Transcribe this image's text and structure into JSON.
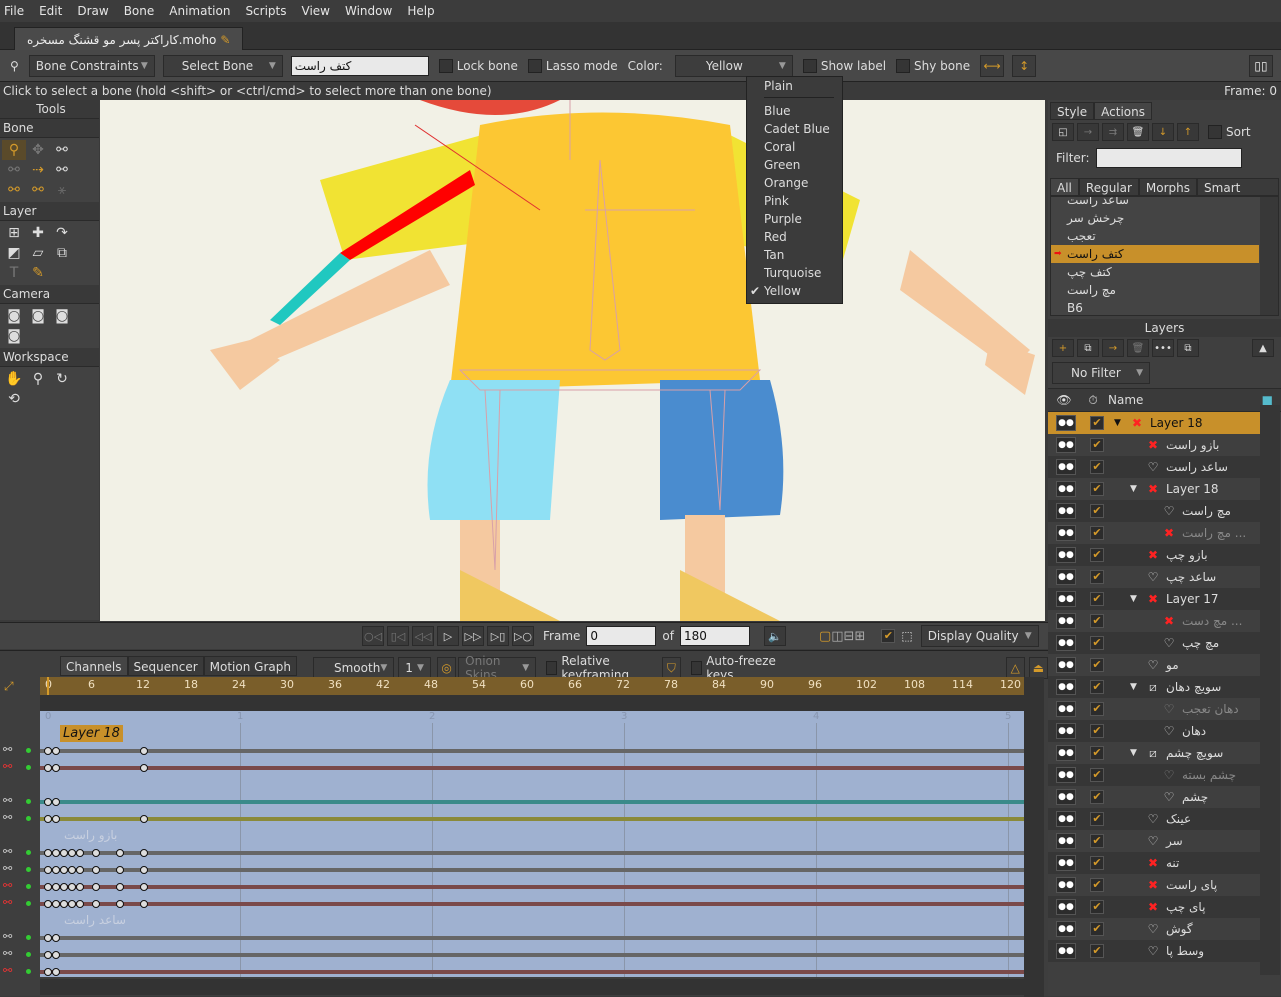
{
  "menu": [
    "File",
    "Edit",
    "Draw",
    "Bone",
    "Animation",
    "Scripts",
    "View",
    "Window",
    "Help"
  ],
  "document_tab": "کاراکتر پسر مو قشنگ مسخره.moho",
  "toolbar": {
    "constraints": "Bone Constraints",
    "select": "Select Bone",
    "bone_name": "کتف راست",
    "lock_bone": "Lock bone",
    "lasso": "Lasso mode",
    "color_label": "Color:",
    "color_value": "Yellow",
    "show_label": "Show label",
    "shy_bone": "Shy bone"
  },
  "status": {
    "hint": "Click to select a bone (hold <shift> or <ctrl/cmd> to select more than one bone)",
    "frame": "Frame: 0"
  },
  "tools": {
    "title": "Tools",
    "sections": [
      "Bone",
      "Layer",
      "Camera",
      "Workspace"
    ]
  },
  "color_menu": {
    "items": [
      "Plain",
      "Blue",
      "Cadet Blue",
      "Coral",
      "Green",
      "Orange",
      "Pink",
      "Purple",
      "Red",
      "Tan",
      "Turquoise",
      "Yellow"
    ],
    "selected": "Yellow"
  },
  "playback": {
    "frame_label": "Frame",
    "frame": "0",
    "of_label": "of",
    "total": "180",
    "display_quality": "Display Quality"
  },
  "timeline": {
    "tabs": [
      "Channels",
      "Sequencer",
      "Motion Graph"
    ],
    "interp": "Smooth",
    "interval": "1",
    "onion": "Onion Skins",
    "relative": "Relative keyframing",
    "autofreeze": "Auto-freeze keys",
    "ruler": [
      "0",
      "6",
      "12",
      "18",
      "24",
      "30",
      "36",
      "42",
      "48",
      "54",
      "60",
      "66",
      "72",
      "78",
      "84",
      "90",
      "96",
      "102",
      "108",
      "114",
      "120"
    ],
    "seconds": [
      "0",
      "1",
      "2",
      "3",
      "4",
      "5"
    ],
    "layer_label": "Layer 18",
    "group_labels": [
      "بازو راست",
      "ساعد راست"
    ]
  },
  "right": {
    "tabs": [
      "Style",
      "Actions"
    ],
    "sort": "Sort",
    "filter_label": "Filter:",
    "filter_value": "",
    "action_tabs": [
      "All",
      "Regular",
      "Morphs",
      "Smart Bones"
    ],
    "actions": [
      "ساعد راست",
      "چرخش سر",
      "تعجب",
      "کتف راست",
      "کتف چپ",
      "مچ راست",
      "B6"
    ],
    "selected_action": "کتف راست",
    "layers_title": "Layers",
    "layer_filter": "No Filter",
    "name_col": "Name",
    "layers": [
      {
        "name": "Layer 18",
        "indent": 0,
        "type": "group-x",
        "expand": true,
        "selected": true
      },
      {
        "name": "بازو راست",
        "indent": 1,
        "type": "x"
      },
      {
        "name": "ساعد راست",
        "indent": 1,
        "type": "vector"
      },
      {
        "name": "Layer 18",
        "indent": 1,
        "type": "group-x",
        "expand": true
      },
      {
        "name": "مچ راست",
        "indent": 2,
        "type": "vector"
      },
      {
        "name": "مچ راست ...",
        "indent": 2,
        "type": "x",
        "dim": true
      },
      {
        "name": "بازو چپ",
        "indent": 1,
        "type": "x"
      },
      {
        "name": "ساعد چپ",
        "indent": 1,
        "type": "vector"
      },
      {
        "name": "Layer 17",
        "indent": 1,
        "type": "group-x",
        "expand": true
      },
      {
        "name": "مچ دست ...",
        "indent": 2,
        "type": "x",
        "dim": true
      },
      {
        "name": "مچ چپ",
        "indent": 2,
        "type": "vector"
      },
      {
        "name": "مو",
        "indent": 1,
        "type": "vector"
      },
      {
        "name": "سویچ دهان",
        "indent": 1,
        "type": "switch",
        "expand": true
      },
      {
        "name": "دهان تعجب",
        "indent": 2,
        "type": "vector",
        "dim": true
      },
      {
        "name": "دهان",
        "indent": 2,
        "type": "vector"
      },
      {
        "name": "سویچ چشم",
        "indent": 1,
        "type": "switch",
        "expand": true
      },
      {
        "name": "چشم بسته",
        "indent": 2,
        "type": "vector",
        "dim": true
      },
      {
        "name": "چشم",
        "indent": 2,
        "type": "vector"
      },
      {
        "name": "عینک",
        "indent": 1,
        "type": "vector"
      },
      {
        "name": "سر",
        "indent": 1,
        "type": "vector"
      },
      {
        "name": "تنه",
        "indent": 1,
        "type": "x"
      },
      {
        "name": "پای راست",
        "indent": 1,
        "type": "x"
      },
      {
        "name": "پای چپ",
        "indent": 1,
        "type": "x"
      },
      {
        "name": "گوش",
        "indent": 1,
        "type": "vector"
      },
      {
        "name": "وسط پا",
        "indent": 1,
        "type": "vector"
      }
    ]
  },
  "colors": {
    "accent": "#c8902a",
    "track_bg": "#9fb1d0",
    "canvas_bg": "#f2f1e6",
    "selected_bone": "#ff0000"
  }
}
